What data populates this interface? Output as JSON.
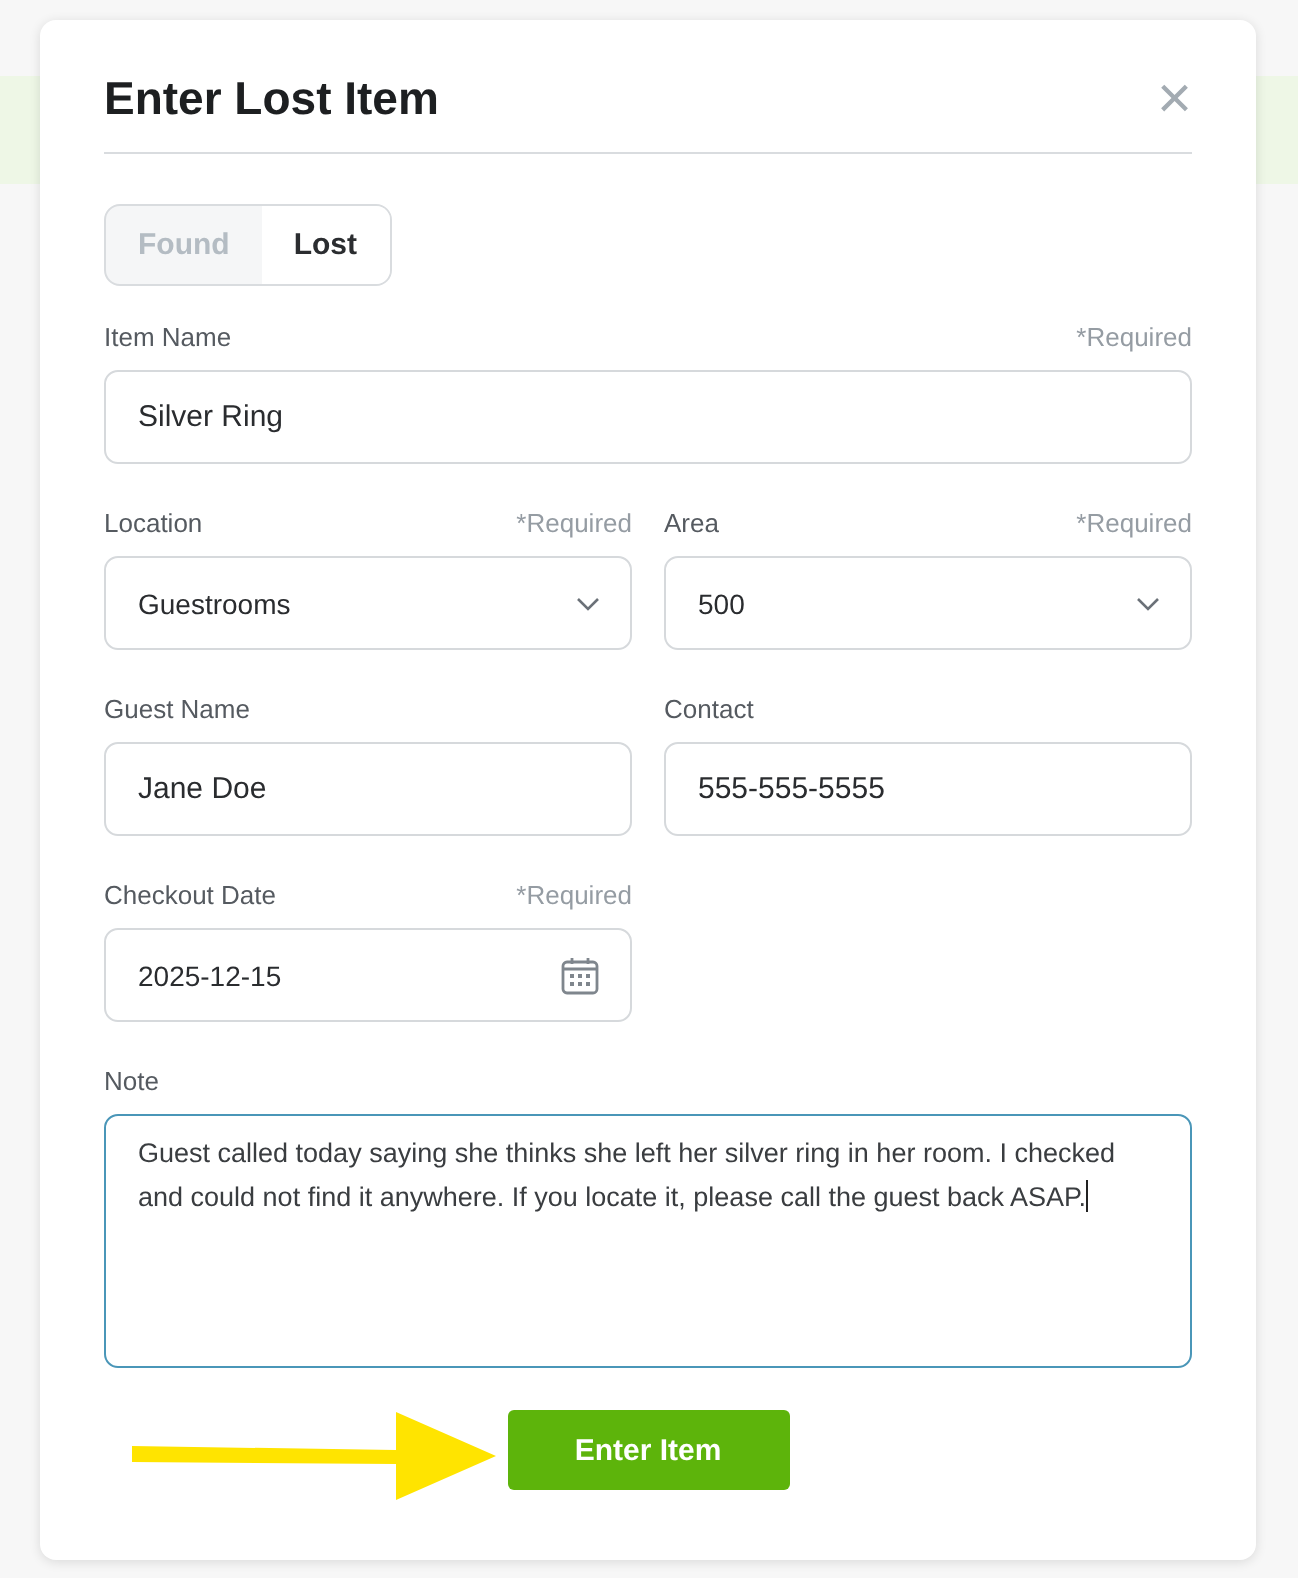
{
  "dialog": {
    "title": "Enter Lost Item",
    "close": "×"
  },
  "toggle": [
    {
      "label": "Found",
      "selected": false
    },
    {
      "label": "Lost",
      "selected": true
    }
  ],
  "rows": [
    {
      "fields": [
        {
          "kind": "text",
          "label": "Item Name",
          "hint": "*Required",
          "value": "Silver Ring"
        }
      ]
    },
    {
      "fields": [
        {
          "kind": "select",
          "label": "Location",
          "hint": "*Required",
          "value": "Guestrooms"
        },
        {
          "kind": "select",
          "label": "Area",
          "hint": "*Required",
          "value": "500"
        }
      ]
    },
    {
      "fields": [
        {
          "kind": "text",
          "label": "Guest Name",
          "value": "Jane Doe"
        },
        {
          "kind": "text",
          "label": "Contact",
          "value": "555-555-5555"
        }
      ]
    },
    {
      "fields": [
        {
          "kind": "date",
          "label": "Checkout Date",
          "hint": "*Required",
          "value": "2025-12-15"
        }
      ]
    },
    {
      "fields": [
        {
          "kind": "textarea",
          "label": "Note",
          "focused": true,
          "value": "Guest called today saying she thinks she left her silver ring in her room. I checked and could not find it anywhere. If you locate it, please call the guest back ASAP."
        }
      ]
    }
  ],
  "submit": "Enter Item"
}
